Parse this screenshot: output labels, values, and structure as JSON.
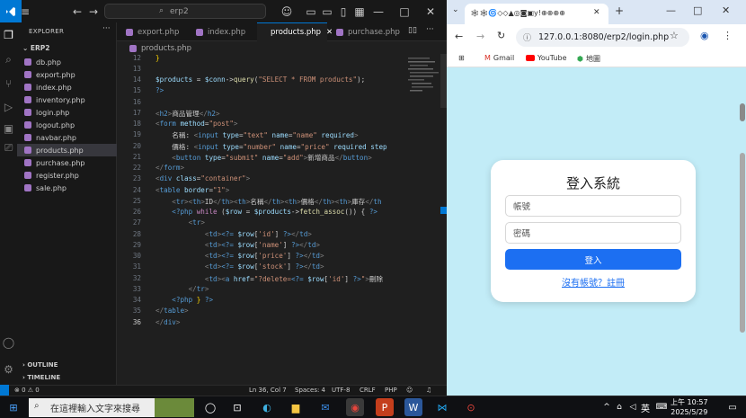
{
  "vscode": {
    "search_text": "erp2",
    "explorer_title": "EXPLORER",
    "folder": "ERP2",
    "files": [
      "db.php",
      "export.php",
      "index.php",
      "inventory.php",
      "login.php",
      "logout.php",
      "navbar.php",
      "products.php",
      "purchase.php",
      "register.php",
      "sale.php"
    ],
    "selected_file": "products.php",
    "outline": "OUTLINE",
    "timeline": "TIMELINE",
    "tabs": [
      "export.php",
      "index.php",
      "products.php",
      "purchase.php"
    ],
    "active_tab": "products.php",
    "breadcrumb": "products.php",
    "line_numbers": [
      "12",
      "13",
      "14",
      "15",
      "16",
      "17",
      "18",
      "19",
      "20",
      "21",
      "22",
      "23",
      "24",
      "25",
      "26",
      "27",
      "28",
      "29",
      "30",
      "31",
      "32",
      "33",
      "34",
      "35",
      "36"
    ],
    "current_line": "36",
    "status": {
      "problems": "0 ⚠ 0",
      "position": "Ln 36, Col 7",
      "spaces": "Spaces: 4",
      "encoding": "UTF-8",
      "eol": "CRLF",
      "language": "PHP"
    }
  },
  "browser": {
    "tab_icons": "🕸🕸🌀◇◇▲◎◙▣y!⊕⊕⊕⊕",
    "url": "127.0.0.1:8080/erp2/login.php",
    "bookmarks": [
      "Gmail",
      "YouTube",
      "地圖"
    ],
    "card": {
      "title": "登入系統",
      "username_placeholder": "帳號",
      "password_placeholder": "密碼",
      "login_button": "登入",
      "register_link": "沒有帳號？註冊"
    }
  },
  "taskbar": {
    "search_placeholder": "在這裡輸入文字來搜尋",
    "lang": "英",
    "time": "上午 10:57",
    "date": "2025/5/29"
  }
}
